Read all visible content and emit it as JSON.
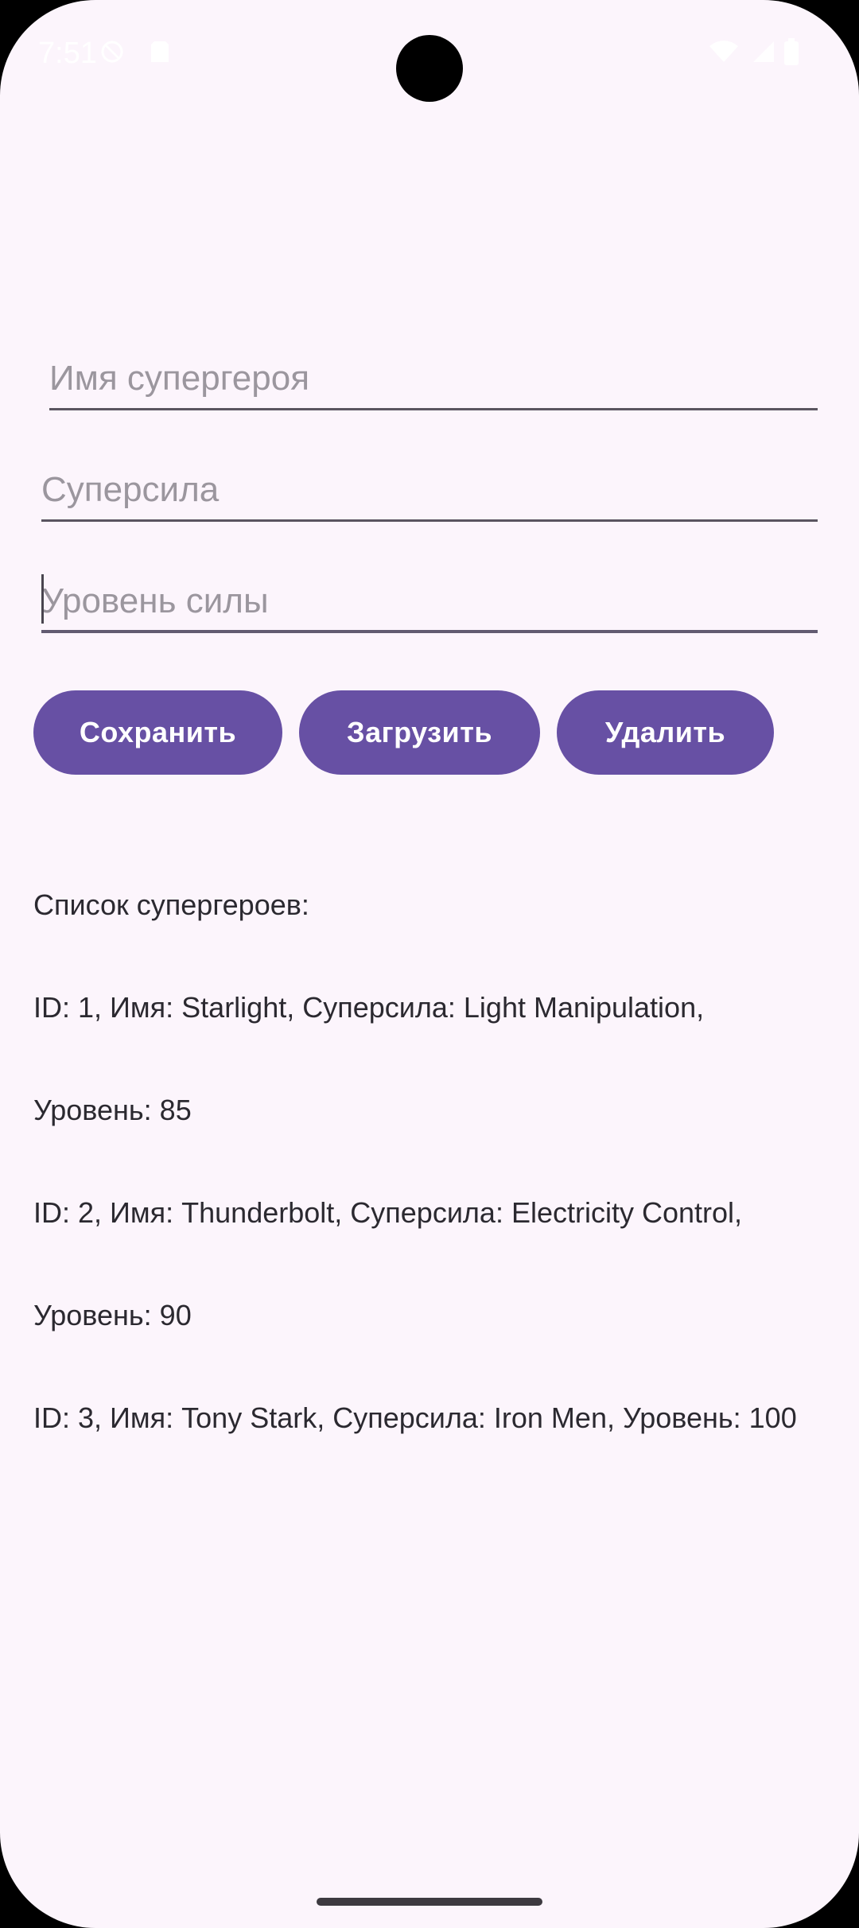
{
  "status_bar": {
    "time": "7:51",
    "icons": [
      "do-not-disturb-icon",
      "sim-card-icon",
      "wifi-icon",
      "signal-icon",
      "battery-icon"
    ]
  },
  "form": {
    "hero_name_placeholder": "Имя супергероя",
    "superpower_placeholder": "Суперсила",
    "power_level_placeholder": "Уровень силы",
    "hero_name_value": "",
    "superpower_value": "",
    "power_level_value": ""
  },
  "buttons": {
    "save_label": "Сохранить",
    "load_label": "Загрузить",
    "delete_label": "Удалить"
  },
  "heroes": {
    "heading": "Список супергероев:",
    "lines": [
      "ID: 1, Имя: Starlight, Суперсила: Light Manipulation,",
      "Уровень: 85",
      "ID: 2, Имя: Thunderbolt, Суперсила: Electricity Control,",
      "Уровень: 90",
      "ID: 3, Имя: Tony Stark, Суперсила: Iron Men, Уровень: 100"
    ]
  },
  "colors": {
    "background": "#FCF5FC",
    "accent": "#6750A4",
    "text": "#2B2930",
    "placeholder": "#9B969E"
  }
}
